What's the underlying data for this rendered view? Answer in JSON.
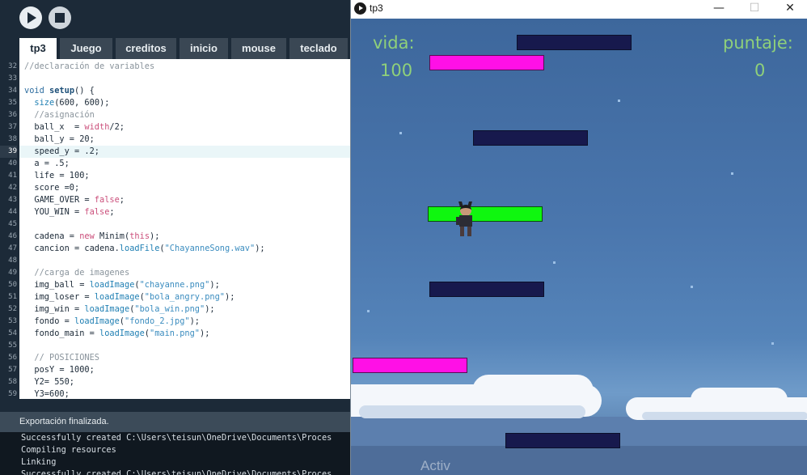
{
  "ide": {
    "tabs": [
      {
        "label": "tp3",
        "active": true
      },
      {
        "label": "Juego"
      },
      {
        "label": "creditos"
      },
      {
        "label": "inicio"
      },
      {
        "label": "mouse"
      },
      {
        "label": "teclado"
      }
    ],
    "line_numbers": [
      "32",
      "33",
      "34",
      "35",
      "36",
      "37",
      "38",
      "39",
      "40",
      "41",
      "42",
      "43",
      "44",
      "45",
      "46",
      "47",
      "48",
      "49",
      "50",
      "51",
      "52",
      "53",
      "54",
      "55",
      "56",
      "57",
      "58",
      "59"
    ],
    "current_line": "39",
    "code_lines": [
      "//declaración de variables",
      "",
      "void setup() {",
      "  size(600, 600);",
      "  //asignación",
      "  ball_x  = width/2;",
      "  ball_y = 20;",
      "  speed_y = .2;",
      "  a = .5;",
      "  life = 100;",
      "  score =0;",
      "  GAME_OVER = false;",
      "  YOU_WIN = false;",
      "",
      "  cadena = new Minim(this);",
      "  cancion = cadena.loadFile(\"ChayanneSong.wav\");",
      "",
      "  //carga de imagenes",
      "  img_ball = loadImage(\"chayanne.png\");",
      "  img_loser = loadImage(\"bola_angry.png\");",
      "  img_win = loadImage(\"bola_win.png\");",
      "  fondo = loadImage(\"fondo_2.jpg\");",
      "  fondo_main = loadImage(\"main.png\");",
      "",
      "  // POSICIONES",
      "  posY = 1000;",
      "  Y2= 550;",
      "  Y3=600;"
    ],
    "status": "Exportación finalizada.",
    "console": [
      "Successfully created C:\\Users\\teisun\\OneDrive\\Documents\\Proces",
      "Compiling resources",
      "Linking",
      "Successfully created C:\\Users\\teisun\\OneDrive\\Documents\\Proces"
    ]
  },
  "game_window": {
    "title": "tp3",
    "minimize_glyph": "—",
    "maximize_glyph": "☐",
    "close_glyph": "✕",
    "hud": {
      "life_label": "vida:",
      "life_value": "100",
      "score_label": "puntaje:",
      "score_value": "0"
    },
    "colors": {
      "hud_text": "#8fd07a",
      "platform_navy": "#17194d",
      "platform_pink": "#ff10e6",
      "platform_green": "#0ff70f"
    }
  },
  "watermark": "Activ"
}
